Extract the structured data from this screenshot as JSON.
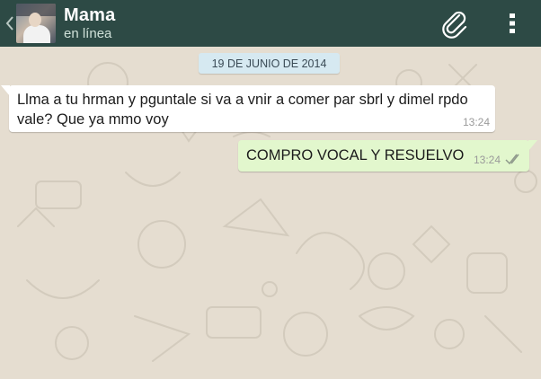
{
  "header": {
    "contact_name": "Mama",
    "status": "en línea",
    "back_icon": "chevron-left-icon",
    "attach_icon": "paperclip-icon",
    "menu_icon": "more-vertical-icon",
    "bar_color": "#2d4a45"
  },
  "chat": {
    "date_separator": "19 DE JUNIO DE 2014",
    "messages": [
      {
        "direction": "incoming",
        "text": "Llma a tu hrman y pguntale si va a vnir a comer par sbrl y dimel rpdo vale? Que ya mmo voy",
        "time": "13:24"
      },
      {
        "direction": "outgoing",
        "text": "COMPRO VOCAL Y RESUELVO",
        "time": "13:24",
        "status_icon": "double-check-icon"
      }
    ],
    "wallpaper_color": "#e5ddd0",
    "incoming_color": "#ffffff",
    "outgoing_color": "#e2f7cd"
  }
}
